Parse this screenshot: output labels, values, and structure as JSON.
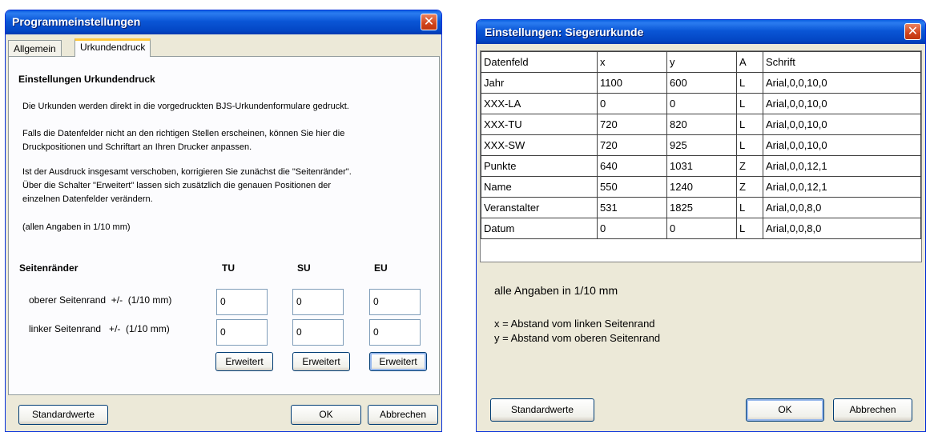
{
  "left_dialog": {
    "title": "Programmeinstellungen",
    "close_symbol": "✕",
    "tabs": [
      {
        "label": "Allgemein"
      },
      {
        "label": "Urkundendruck"
      }
    ],
    "heading": "Einstellungen Urkundendruck",
    "paragraph1": "Die Urkunden werden direkt in die vorgedruckten BJS-Urkundenformulare gedruckt.",
    "paragraph2_line1": "Falls die Datenfelder nicht an den richtigen Stellen erscheinen, können Sie hier die",
    "paragraph2_line2": "Druckpositionen und Schriftart an Ihren Drucker anpassen.",
    "paragraph3_line1": "Ist der Ausdruck insgesamt verschoben, korrigieren Sie zunächst die \"Seitenränder\".",
    "paragraph3_line2": "Über die Schalter \"Erweitert\" lassen sich zusätzlich die genauen Positionen der",
    "paragraph3_line3": "einzelnen Datenfelder verändern.",
    "units_note": "(allen Angaben in 1/10 mm)",
    "margins_heading": "Seitenränder",
    "columns": [
      "TU",
      "SU",
      "EU"
    ],
    "rows": [
      {
        "label": "oberer Seitenrand  +/-  (1/10 mm)",
        "values": [
          "0",
          "0",
          "0"
        ]
      },
      {
        "label": "linker Seitenrand   +/-  (1/10 mm)",
        "values": [
          "0",
          "0",
          "0"
        ]
      }
    ],
    "advanced_label": "Erweitert",
    "defaults_label": "Standardwerte",
    "ok_label": "OK",
    "cancel_label": "Abbrechen"
  },
  "right_dialog": {
    "title": "Einstellungen: Siegerurkunde",
    "close_symbol": "✕",
    "table": {
      "headers": [
        "Datenfeld",
        "x",
        "y",
        "A",
        "Schrift"
      ],
      "rows": [
        [
          "Jahr",
          "1100",
          "600",
          "L",
          "Arial,0,0,10,0"
        ],
        [
          "XXX-LA",
          "0",
          "0",
          "L",
          "Arial,0,0,10,0"
        ],
        [
          "XXX-TU",
          "720",
          "820",
          "L",
          "Arial,0,0,10,0"
        ],
        [
          "XXX-SW",
          "720",
          "925",
          "L",
          "Arial,0,0,10,0"
        ],
        [
          "Punkte",
          "640",
          "1031",
          "Z",
          "Arial,0,0,12,1"
        ],
        [
          "Name",
          "550",
          "1240",
          "Z",
          "Arial,0,0,12,1"
        ],
        [
          "Veranstalter",
          "531",
          "1825",
          "L",
          "Arial,0,0,8,0"
        ],
        [
          "Datum",
          "0",
          "0",
          "L",
          "Arial,0,0,8,0"
        ]
      ]
    },
    "units_note": "alle Angaben in 1/10 mm",
    "legend_x": "x = Abstand vom linken Seitenrand",
    "legend_y": "y = Abstand vom oberen Seitenrand",
    "defaults_label": "Standardwerte",
    "ok_label": "OK",
    "cancel_label": "Abbrechen"
  },
  "colors": {
    "titlebar": "#0a56d6",
    "dialog_bg": "#ece9d8",
    "active_tab_accent": "#ffc83c",
    "close_button": "#d1441c"
  }
}
